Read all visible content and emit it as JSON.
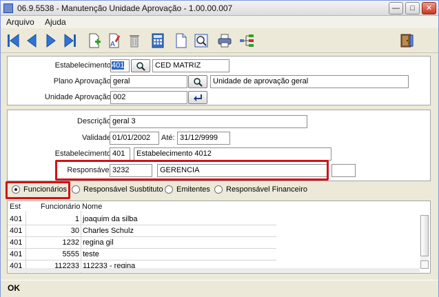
{
  "window": {
    "title": "06.9.5538 - Manutenção Unidade Aprovação - 1.00.00.007",
    "minimize_glyph": "—",
    "maximize_glyph": "□",
    "close_glyph": "✕"
  },
  "menu": {
    "items": [
      "Arquivo",
      "Ajuda"
    ]
  },
  "toolbar": {
    "icons": [
      "first-record-icon",
      "previous-record-icon",
      "next-record-icon",
      "last-record-icon",
      "new-record-icon",
      "edit-record-icon",
      "delete-record-icon",
      "calculator-icon",
      "document-icon",
      "print-preview-icon",
      "print-icon",
      "tree-structure-icon",
      "exit-door-icon"
    ]
  },
  "header_form": {
    "estabelecimento_label": "Estabelecimento:",
    "estabelecimento_code": "401",
    "estabelecimento_name": "CED MATRIZ",
    "plano_label": "Plano Aprovação:",
    "plano_code": "geral",
    "plano_name": "Unidade de aprovação geral",
    "unidade_label": "Unidade Aprovação:",
    "unidade_code": "002"
  },
  "detail_form": {
    "descricao_label": "Descrição:",
    "descricao_value": "geral 3",
    "validade_label": "Validade:",
    "validade_start": "01/01/2002",
    "ate_label": "Até:",
    "validade_end": "31/12/9999",
    "estabelecimento_label": "Estabelecimento:",
    "estabelecimento_code": "401",
    "estabelecimento_name": "Estabelecimento 4012",
    "responsavel_label": "Responsável:",
    "responsavel_code": "3232",
    "responsavel_name": "GERENCIA",
    "extra_value": ""
  },
  "radios": {
    "options": [
      "Funcionários",
      "Responsável Susbtituto",
      "Emitentes",
      "Responsável Financeiro"
    ],
    "selected": 0
  },
  "table": {
    "columns": [
      "Est",
      "Funcionário",
      "Nome"
    ],
    "rows": [
      [
        "401",
        "1",
        "joaquim da silba"
      ],
      [
        "401",
        "30",
        "Charles Schulz"
      ],
      [
        "401",
        "1232",
        "regina gil"
      ],
      [
        "401",
        "5555",
        "teste"
      ],
      [
        "401",
        "112233",
        "112233 - regina"
      ]
    ]
  },
  "status": {
    "text": "OK"
  },
  "colors": {
    "highlight_red": "#d21016",
    "selection_blue": "#316ac5",
    "window_bg": "#ece9d8"
  }
}
